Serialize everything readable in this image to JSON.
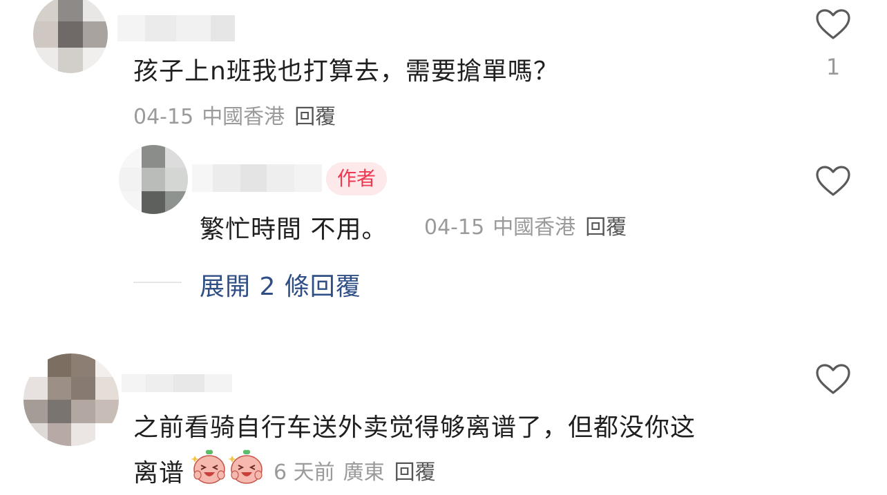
{
  "comments": [
    {
      "text": "孩子上n班我也打算去，需要搶單嗎？",
      "date": "04-15",
      "location": "中國香港",
      "reply_label": "回覆",
      "likes": "1",
      "reply": {
        "badge": "作者",
        "text": "繁忙時間 不用。",
        "date": "04-15",
        "location": "中國香港",
        "reply_label": "回覆"
      },
      "expand_label": "展開 2 條回覆"
    },
    {
      "text_line1": "之前看骑自行车送外卖觉得够离谱了，但都没你这",
      "text_line2": "离谱",
      "emoji": "laughing-face-emoji",
      "date": "6 天前",
      "location": "廣東",
      "reply_label": "回覆"
    }
  ],
  "icons": {
    "like": "heart-outline-icon"
  },
  "colors": {
    "badge_bg": "#fde8ea",
    "badge_text": "#ee3850",
    "link": "#2f4e86",
    "meta": "#9a9a9a"
  }
}
